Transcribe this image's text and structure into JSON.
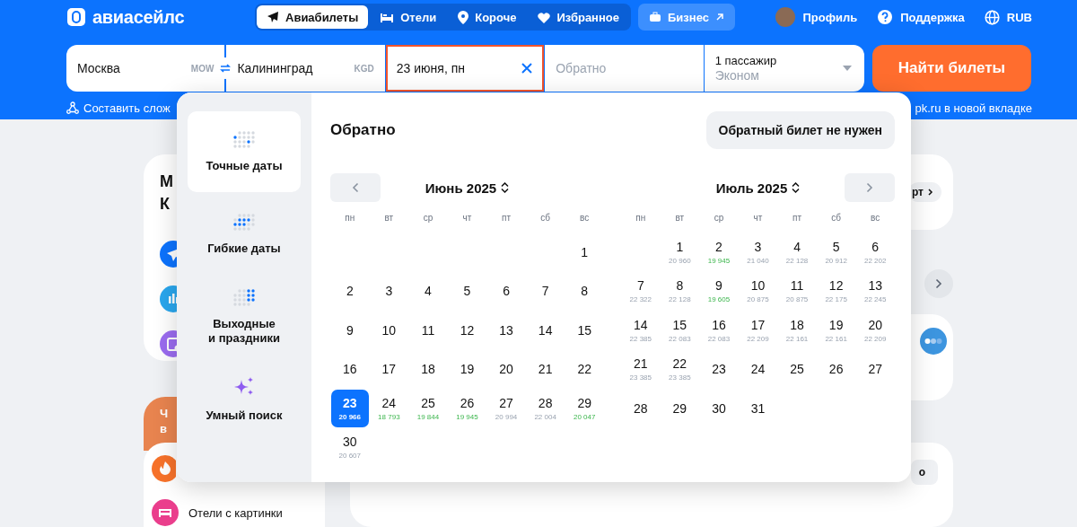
{
  "header": {
    "logo": "авиасейлс",
    "nav": [
      {
        "label": "Авиабилеты",
        "kind": "flights",
        "selected": true
      },
      {
        "label": "Отели",
        "kind": "hotels",
        "selected": false
      },
      {
        "label": "Короче",
        "kind": "places",
        "selected": false
      },
      {
        "label": "Избранное",
        "kind": "favorites",
        "selected": false
      }
    ],
    "business": "Бизнес",
    "profile": "Профиль",
    "support": "Поддержка",
    "currency": "RUB"
  },
  "search": {
    "fields": [
      {
        "kind": "place",
        "value": "Москва",
        "code": "MOW"
      },
      {
        "kind": "place",
        "value": "Калининград",
        "code": "KGD"
      },
      {
        "kind": "date",
        "value": "23 июня, пн",
        "active": true
      },
      {
        "kind": "date",
        "placeholder": "Обратно",
        "active": false
      },
      {
        "kind": "passengers",
        "value": "1 пассажир",
        "class": "Эконом"
      }
    ],
    "button": "Найти билеты",
    "links": [
      "Составить слож",
      "pk.ru в новой вкладке"
    ]
  },
  "background": {
    "card_title": [
      "М",
      "К"
    ],
    "promo_title": [
      "Ч",
      "в"
    ],
    "list_item": "Отели с картинки",
    "chip_top": "рт",
    "chip_bottom": "о"
  },
  "date_picker": {
    "modes": [
      {
        "label": "Точные даты",
        "kind": "exact",
        "selected": true
      },
      {
        "label": "Гибкие даты",
        "kind": "flexible",
        "selected": false
      },
      {
        "label": "Выходные и праздники",
        "kind": "weekends",
        "selected": false
      },
      {
        "label": "Умный поиск",
        "kind": "smart",
        "selected": false
      }
    ],
    "title": "Обратно",
    "no_return_button": "Обратный билет не нужен",
    "months": [
      {
        "title": "Июнь 2025",
        "weekdays": [
          "пн",
          "вт",
          "ср",
          "чт",
          "пт",
          "сб",
          "вс"
        ],
        "weeks": [
          {
            "kind": "leading",
            "days": [
              {
                "day": "1",
                "selected": false
              }
            ]
          },
          {
            "kind": "full",
            "days": [
              {
                "day": "2",
                "selected": false
              },
              {
                "day": "3",
                "selected": false
              },
              {
                "day": "4",
                "selected": false
              },
              {
                "day": "5",
                "selected": false
              },
              {
                "day": "6",
                "selected": false
              },
              {
                "day": "7",
                "selected": false
              },
              {
                "day": "8",
                "selected": false
              }
            ]
          },
          {
            "kind": "full",
            "days": [
              {
                "day": "9",
                "selected": false
              },
              {
                "day": "10",
                "selected": false
              },
              {
                "day": "11",
                "selected": false
              },
              {
                "day": "12",
                "selected": false
              },
              {
                "day": "13",
                "selected": false
              },
              {
                "day": "14",
                "selected": false
              },
              {
                "day": "15",
                "selected": false
              }
            ]
          },
          {
            "kind": "full",
            "days": [
              {
                "day": "16",
                "selected": false
              },
              {
                "day": "17",
                "selected": false
              },
              {
                "day": "18",
                "selected": false
              },
              {
                "day": "19",
                "selected": false
              },
              {
                "day": "20",
                "selected": false
              },
              {
                "day": "21",
                "selected": false
              },
              {
                "day": "22",
                "selected": false
              }
            ]
          },
          {
            "kind": "full",
            "days": [
              {
                "day": "23",
                "price": "20 966",
                "cheap": false,
                "selected": true
              },
              {
                "day": "24",
                "price": "18 793",
                "cheap": true,
                "selected": false
              },
              {
                "day": "25",
                "price": "19 844",
                "cheap": true,
                "selected": false
              },
              {
                "day": "26",
                "price": "19 945",
                "cheap": true,
                "selected": false
              },
              {
                "day": "27",
                "price": "20 994",
                "cheap": false,
                "selected": false
              },
              {
                "day": "28",
                "price": "22 004",
                "cheap": false,
                "selected": false
              },
              {
                "day": "29",
                "price": "20 047",
                "cheap": true,
                "selected": false
              }
            ]
          },
          {
            "kind": "trailing",
            "days": [
              {
                "day": "30",
                "price": "20 607",
                "cheap": false,
                "selected": false
              }
            ]
          }
        ]
      },
      {
        "title": "Июль 2025",
        "weekdays": [
          "пн",
          "вт",
          "ср",
          "чт",
          "пт",
          "сб",
          "вс"
        ],
        "weeks": [
          {
            "kind": "leading",
            "days": [
              {
                "day": "1",
                "price": "20 960",
                "cheap": false,
                "selected": false
              },
              {
                "day": "2",
                "price": "19 945",
                "cheap": true,
                "selected": false
              },
              {
                "day": "3",
                "price": "21 040",
                "cheap": false,
                "selected": false
              },
              {
                "day": "4",
                "price": "22 128",
                "cheap": false,
                "selected": false
              },
              {
                "day": "5",
                "price": "20 912",
                "cheap": false,
                "selected": false
              },
              {
                "day": "6",
                "price": "22 202",
                "cheap": false,
                "selected": false
              }
            ]
          },
          {
            "kind": "full",
            "days": [
              {
                "day": "7",
                "price": "22 322",
                "cheap": false,
                "selected": false
              },
              {
                "day": "8",
                "price": "22 128",
                "cheap": false,
                "selected": false
              },
              {
                "day": "9",
                "price": "19 605",
                "cheap": true,
                "selected": false
              },
              {
                "day": "10",
                "price": "20 875",
                "cheap": false,
                "selected": false
              },
              {
                "day": "11",
                "price": "20 875",
                "cheap": false,
                "selected": false
              },
              {
                "day": "12",
                "price": "22 175",
                "cheap": false,
                "selected": false
              },
              {
                "day": "13",
                "price": "22 245",
                "cheap": false,
                "selected": false
              }
            ]
          },
          {
            "kind": "full",
            "days": [
              {
                "day": "14",
                "price": "22 385",
                "cheap": false,
                "selected": false
              },
              {
                "day": "15",
                "price": "22 083",
                "cheap": false,
                "selected": false
              },
              {
                "day": "16",
                "price": "22 083",
                "cheap": false,
                "selected": false
              },
              {
                "day": "17",
                "price": "22 209",
                "cheap": false,
                "selected": false
              },
              {
                "day": "18",
                "price": "22 161",
                "cheap": false,
                "selected": false
              },
              {
                "day": "19",
                "price": "22 161",
                "cheap": false,
                "selected": false
              },
              {
                "day": "20",
                "price": "22 209",
                "cheap": false,
                "selected": false
              }
            ]
          },
          {
            "kind": "full",
            "days": [
              {
                "day": "21",
                "price": "23 385",
                "cheap": false,
                "selected": false
              },
              {
                "day": "22",
                "price": "23 385",
                "cheap": false,
                "selected": false
              },
              {
                "day": "23",
                "selected": false
              },
              {
                "day": "24",
                "selected": false
              },
              {
                "day": "25",
                "selected": false
              },
              {
                "day": "26",
                "selected": false
              },
              {
                "day": "27",
                "selected": false
              }
            ]
          },
          {
            "kind": "trailing",
            "days": [
              {
                "day": "28",
                "selected": false
              },
              {
                "day": "29",
                "selected": false
              },
              {
                "day": "30",
                "selected": false
              },
              {
                "day": "31",
                "selected": false
              }
            ]
          }
        ]
      }
    ]
  }
}
